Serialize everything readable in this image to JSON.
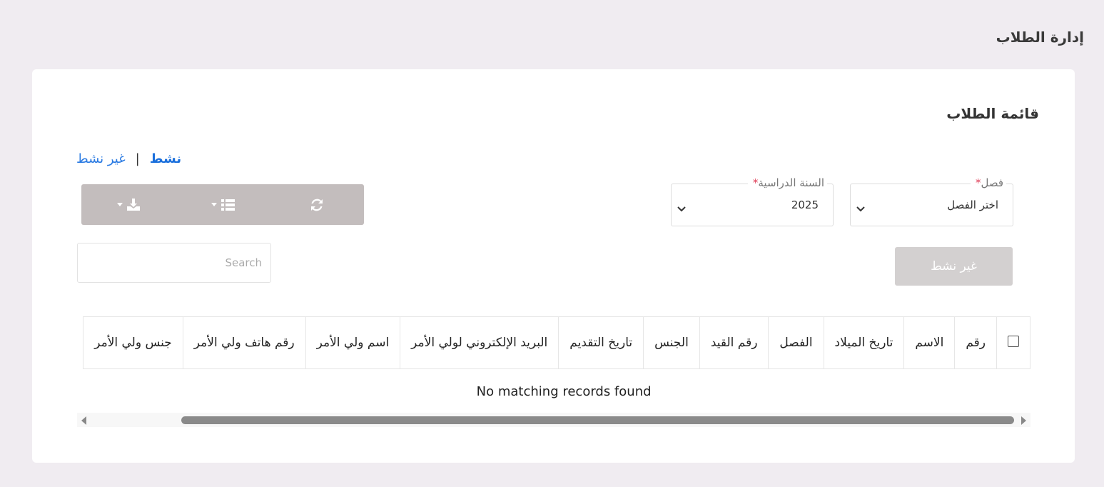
{
  "page": {
    "title": "إدارة الطلاب"
  },
  "card": {
    "title": "قائمة الطلاب"
  },
  "status_filter": {
    "active": "نشط",
    "separator": "|",
    "inactive": "غير نشط"
  },
  "toolbar": {
    "refresh_icon": "refresh-icon",
    "columns_icon": "list-columns-icon",
    "export_icon": "download-icon"
  },
  "filters": {
    "class": {
      "label": "فصل",
      "required": "*",
      "value": "اختر الفصل"
    },
    "year": {
      "label": "السنة الدراسية",
      "required": "*",
      "value": "2025"
    }
  },
  "search": {
    "placeholder": "Search"
  },
  "inactive_button": {
    "label": "غير نشط"
  },
  "table": {
    "columns": [
      "رقم",
      "الاسم",
      "تاريخ الميلاد",
      "الفصل",
      "رقم القيد",
      "الجنس",
      "تاريخ التقديم",
      "البريد الإلكتروني لولي الأمر",
      "اسم ولي الأمر",
      "رقم هاتف ولي الأمر",
      "جنس ولي الأمر"
    ],
    "empty_message": "No matching records found"
  }
}
